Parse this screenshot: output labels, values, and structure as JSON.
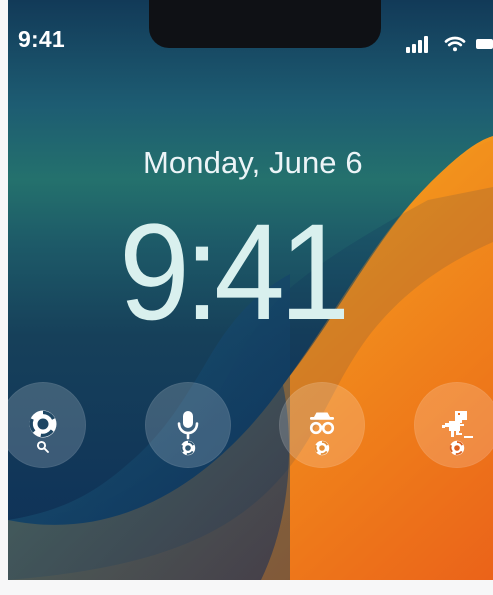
{
  "status_bar": {
    "time": "9:41",
    "signal_icon": "signal-icon",
    "wifi_icon": "wifi-icon",
    "battery_icon": "battery-icon"
  },
  "lock_screen": {
    "date": "Monday, June 6",
    "time": "9:41"
  },
  "widgets": [
    {
      "main_icon": "chrome-icon",
      "sub_icon": "search-icon"
    },
    {
      "main_icon": "microphone-icon",
      "sub_icon": "chrome-icon"
    },
    {
      "main_icon": "incognito-icon",
      "sub_icon": "chrome-icon"
    },
    {
      "main_icon": "dino-icon",
      "sub_icon": "chrome-icon"
    }
  ],
  "colors": {
    "teal": "#24716d",
    "blue": "#0d2f58",
    "orange": "#f07a1e",
    "yellow": "#f3b529",
    "red_orange": "#e34a14"
  }
}
